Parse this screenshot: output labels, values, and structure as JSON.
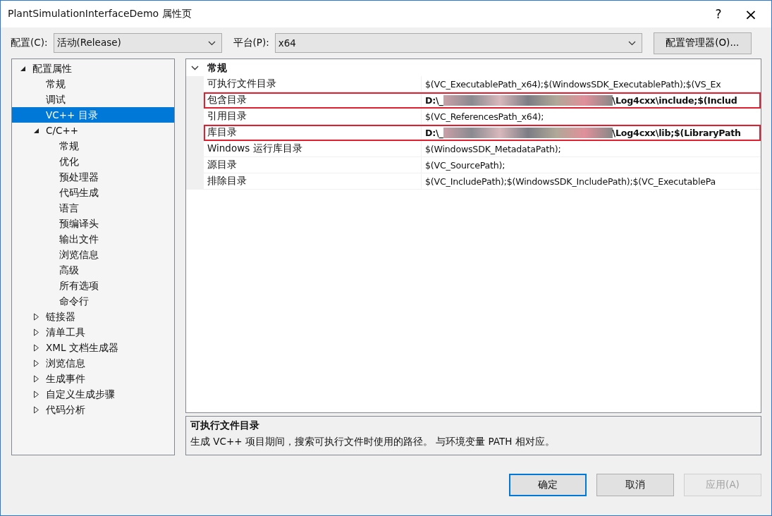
{
  "window": {
    "title": "PlantSimulationInterfaceDemo 属性页",
    "help": "?",
    "close": "×"
  },
  "toolbar": {
    "config_label": "配置(C):",
    "config_value": "活动(Release)",
    "platform_label": "平台(P):",
    "platform_value": "x64",
    "manager_button": "配置管理器(O)..."
  },
  "tree": [
    {
      "label": "配置属性",
      "expanded": true,
      "selected": false,
      "children": [
        {
          "label": "常规",
          "selected": false
        },
        {
          "label": "调试",
          "selected": false
        },
        {
          "label": "VC++ 目录",
          "selected": true
        },
        {
          "label": "C/C++",
          "expanded": true,
          "selected": false,
          "children": [
            {
              "label": "常规",
              "selected": false
            },
            {
              "label": "优化",
              "selected": false
            },
            {
              "label": "预处理器",
              "selected": false
            },
            {
              "label": "代码生成",
              "selected": false
            },
            {
              "label": "语言",
              "selected": false
            },
            {
              "label": "预编译头",
              "selected": false
            },
            {
              "label": "输出文件",
              "selected": false
            },
            {
              "label": "浏览信息",
              "selected": false
            },
            {
              "label": "高级",
              "selected": false
            },
            {
              "label": "所有选项",
              "selected": false
            },
            {
              "label": "命令行",
              "selected": false
            }
          ]
        },
        {
          "label": "链接器",
          "expanded": false,
          "selected": false
        },
        {
          "label": "清单工具",
          "expanded": false,
          "selected": false
        },
        {
          "label": "XML 文档生成器",
          "expanded": false,
          "selected": false
        },
        {
          "label": "浏览信息",
          "expanded": false,
          "selected": false
        },
        {
          "label": "生成事件",
          "expanded": false,
          "selected": false
        },
        {
          "label": "自定义生成步骤",
          "expanded": false,
          "selected": false
        },
        {
          "label": "代码分析",
          "expanded": false,
          "selected": false
        }
      ]
    }
  ],
  "grid": {
    "category": "常规",
    "expanded": true,
    "rows": [
      {
        "name": "可执行文件目录",
        "value": "$(VC_ExecutablePath_x64);$(WindowsSDK_ExecutablePath);$(VS_Ex",
        "bold": false,
        "highlighted": false
      },
      {
        "name": "包含目录",
        "value_prefix": "D:\\_",
        "redacted": true,
        "value": "\\Log4cxx\\include;$(Includ",
        "bold": true,
        "highlighted": true
      },
      {
        "name": "引用目录",
        "value": "$(VC_ReferencesPath_x64);",
        "bold": false,
        "highlighted": false
      },
      {
        "name": "库目录",
        "value_prefix": "D:\\_",
        "redacted": true,
        "value": "\\Log4cxx\\lib;$(LibraryPath",
        "bold": true,
        "highlighted": true
      },
      {
        "name": "Windows 运行库目录",
        "value": "$(WindowsSDK_MetadataPath);",
        "bold": false,
        "highlighted": false
      },
      {
        "name": "源目录",
        "value": "$(VC_SourcePath);",
        "bold": false,
        "highlighted": false
      },
      {
        "name": "排除目录",
        "value": "$(VC_IncludePath);$(WindowsSDK_IncludePath);$(VC_ExecutablePa",
        "bold": false,
        "highlighted": false
      }
    ]
  },
  "description": {
    "title": "可执行文件目录",
    "text": "生成 VC++ 项目期间，搜索可执行文件时使用的路径。 与环境变量 PATH 相对应。"
  },
  "buttons": [
    {
      "label": "确定",
      "default": true,
      "disabled": false
    },
    {
      "label": "取消",
      "default": false,
      "disabled": false
    },
    {
      "label": "应用(A)",
      "default": false,
      "disabled": true
    }
  ]
}
